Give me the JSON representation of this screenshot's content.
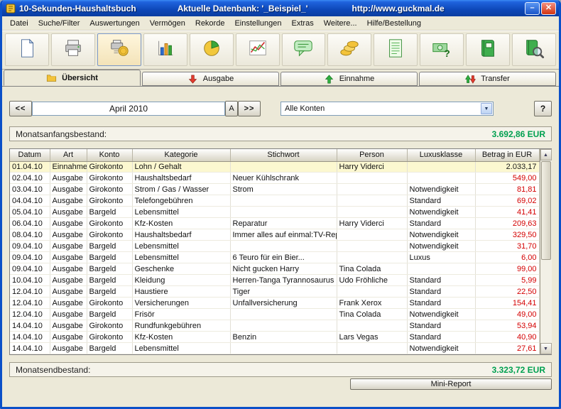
{
  "window": {
    "title": "10-Sekunden-Haushaltsbuch",
    "database_label": "Aktuelle Datenbank: '_Beispiel_'",
    "url": "http://www.guckmal.de",
    "controls": [
      {
        "icon": "minimize-icon",
        "glyph": "–"
      },
      {
        "icon": "close-icon",
        "glyph": "✕"
      }
    ]
  },
  "menu": {
    "items": [
      "Datei",
      "Suche/Filter",
      "Auswertungen",
      "Vermögen",
      "Rekorde",
      "Einstellungen",
      "Extras",
      "Weitere...",
      "Hilfe/Bestellung"
    ]
  },
  "toolbar": {
    "buttons": [
      {
        "icon": "new-document-icon"
      },
      {
        "icon": "print-icon"
      },
      {
        "icon": "print-money-icon",
        "active": true
      },
      {
        "icon": "bar-chart-icon"
      },
      {
        "icon": "pie-chart-icon"
      },
      {
        "icon": "line-chart-icon"
      },
      {
        "icon": "comment-icon"
      },
      {
        "icon": "coins-icon"
      },
      {
        "icon": "notes-icon"
      },
      {
        "icon": "money-question-icon"
      },
      {
        "icon": "book-icon"
      },
      {
        "icon": "book-search-icon"
      }
    ]
  },
  "tabs": [
    {
      "label": "Übersicht",
      "icon": "folder-icon",
      "active": true
    },
    {
      "label": "Ausgabe",
      "icon": "arrow-down-red-icon",
      "active": false
    },
    {
      "label": "Einnahme",
      "icon": "arrow-up-green-icon",
      "active": false
    },
    {
      "label": "Transfer",
      "icon": "transfer-arrows-icon",
      "active": false
    }
  ],
  "navigation": {
    "prev_label": "<<",
    "period": "April 2010",
    "auto_label": "A",
    "next_label": ">>",
    "account_filter": "Alle Konten",
    "help_label": "?"
  },
  "summary": {
    "start_label": "Monatsanfangsbestand:",
    "start_value": "3.692,86 EUR",
    "end_label": "Monatsendbestand:",
    "end_value": "3.323,72 EUR"
  },
  "table": {
    "columns": [
      "Datum",
      "Art",
      "Konto",
      "Kategorie",
      "Stichwort",
      "Person",
      "Luxusklasse",
      "Betrag in EUR"
    ],
    "selected_row": 0,
    "rows": [
      [
        "01.04.10",
        "Einnahme",
        "Girokonto",
        "Lohn / Gehalt",
        "",
        "Harry Viderci",
        "",
        "2.033,17"
      ],
      [
        "02.04.10",
        "Ausgabe",
        "Girokonto",
        "Haushaltsbedarf",
        "Neuer Kühlschrank",
        "",
        "",
        "549,00"
      ],
      [
        "03.04.10",
        "Ausgabe",
        "Girokonto",
        "Strom / Gas / Wasser",
        "Strom",
        "",
        "Notwendigkeit",
        "81,81"
      ],
      [
        "04.04.10",
        "Ausgabe",
        "Girokonto",
        "Telefongebühren",
        "",
        "",
        "Standard",
        "69,02"
      ],
      [
        "05.04.10",
        "Ausgabe",
        "Bargeld",
        "Lebensmittel",
        "",
        "",
        "Notwendigkeit",
        "41,41"
      ],
      [
        "06.04.10",
        "Ausgabe",
        "Girokonto",
        "Kfz-Kosten",
        "Reparatur",
        "Harry Viderci",
        "Standard",
        "209,63"
      ],
      [
        "08.04.10",
        "Ausgabe",
        "Girokonto",
        "Haushaltsbedarf",
        "Immer alles auf einmal:TV-Rep.",
        "",
        "Notwendigkeit",
        "329,50"
      ],
      [
        "09.04.10",
        "Ausgabe",
        "Bargeld",
        "Lebensmittel",
        "",
        "",
        "Notwendigkeit",
        "31,70"
      ],
      [
        "09.04.10",
        "Ausgabe",
        "Bargeld",
        "Lebensmittel",
        "6 Teuro für ein Bier...",
        "",
        "Luxus",
        "6,00"
      ],
      [
        "09.04.10",
        "Ausgabe",
        "Bargeld",
        "Geschenke",
        "Nicht gucken Harry",
        "Tina Colada",
        "",
        "99,00"
      ],
      [
        "10.04.10",
        "Ausgabe",
        "Bargeld",
        "Kleidung",
        "Herren-Tanga Tyrannosaurus r",
        "Udo Fröhliche",
        "Standard",
        "5,99"
      ],
      [
        "12.04.10",
        "Ausgabe",
        "Bargeld",
        "Haustiere",
        "Tiger",
        "",
        "Standard",
        "22,50"
      ],
      [
        "12.04.10",
        "Ausgabe",
        "Girokonto",
        "Versicherungen",
        "Unfallversicherung",
        "Frank Xerox",
        "Standard",
        "154,41"
      ],
      [
        "12.04.10",
        "Ausgabe",
        "Bargeld",
        "Frisör",
        "",
        "Tina Colada",
        "Notwendigkeit",
        "49,00"
      ],
      [
        "14.04.10",
        "Ausgabe",
        "Girokonto",
        "Rundfunkgebühren",
        "",
        "",
        "Standard",
        "53,94"
      ],
      [
        "14.04.10",
        "Ausgabe",
        "Girokonto",
        "Kfz-Kosten",
        "Benzin",
        "Lars Vegas",
        "Standard",
        "40,90"
      ],
      [
        "14.04.10",
        "Ausgabe",
        "Bargeld",
        "Lebensmittel",
        "",
        "",
        "Notwendigkeit",
        "27,61"
      ]
    ]
  },
  "footer": {
    "mini_report_label": "Mini-Report"
  },
  "icons": {
    "chevron_down": "▼",
    "scroll_up": "▲",
    "scroll_down": "▼"
  },
  "colors": {
    "positive_value": "#00a050",
    "expense_text": "#d40000",
    "selected_row_bg": "#fcf8d0",
    "titlebar_blue": "#1f63dd"
  }
}
